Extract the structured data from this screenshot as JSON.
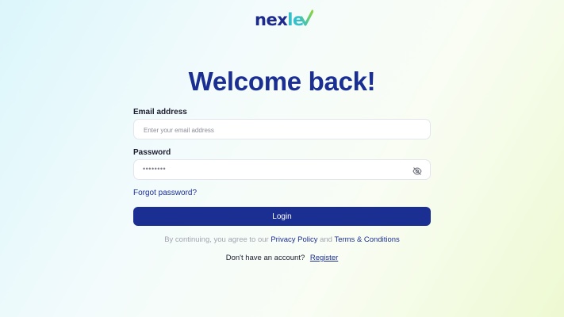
{
  "brand": {
    "logo_part1": "nex",
    "logo_part2": "le",
    "colors": {
      "navy": "#1b2f93",
      "teal": "#35c0c9",
      "green": "#7fd24a"
    }
  },
  "page": {
    "title": "Welcome back!"
  },
  "form": {
    "email": {
      "label": "Email address",
      "placeholder": "Enter your email address",
      "value": ""
    },
    "password": {
      "label": "Password",
      "value": "••••••••",
      "toggle_icon": "eye-off-icon"
    },
    "forgot_label": "Forgot password?",
    "login_label": "Login"
  },
  "terms": {
    "prefix": "By continuing, you agree to our ",
    "privacy": "Privacy Policy",
    "and": " and ",
    "conditions": "Terms & Conditions"
  },
  "register": {
    "prompt": "Don't have an account?",
    "link": "Register"
  }
}
